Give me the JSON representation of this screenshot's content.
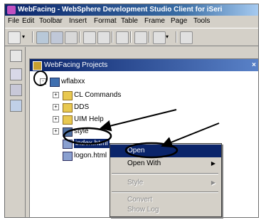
{
  "window": {
    "title": "WebFacing - WebSphere Development Studio Client for iSeri"
  },
  "menubar": [
    "File",
    "Edit",
    "Toolbar",
    "Insert",
    "Format",
    "Table",
    "Frame",
    "Page",
    "Tools"
  ],
  "view": {
    "title": "WebFacing Projects",
    "close": "×"
  },
  "tree": {
    "project": "wflabxx",
    "items": [
      "CL Commands",
      "DDS",
      "UIM Help",
      "style",
      "index.html",
      "logon.html"
    ]
  },
  "context_menu": {
    "items": [
      {
        "label": "Open",
        "selected": true,
        "enabled": true
      },
      {
        "label": "Open With",
        "submenu": true,
        "enabled": true
      },
      {
        "label": "Style",
        "submenu": true,
        "enabled": false
      },
      {
        "label": "Convert",
        "enabled": false
      },
      {
        "label": "Show Log",
        "enabled": false
      }
    ]
  },
  "icons": {
    "title": "websphere-logo-icon",
    "view": "webfacing-projects-icon",
    "folder": "folder-icon",
    "file": "html-file-icon"
  },
  "colors": {
    "title_bar": "#0a246a",
    "selection": "#0a246a",
    "annotation": "#000000",
    "chrome": "#d4d0c8"
  }
}
